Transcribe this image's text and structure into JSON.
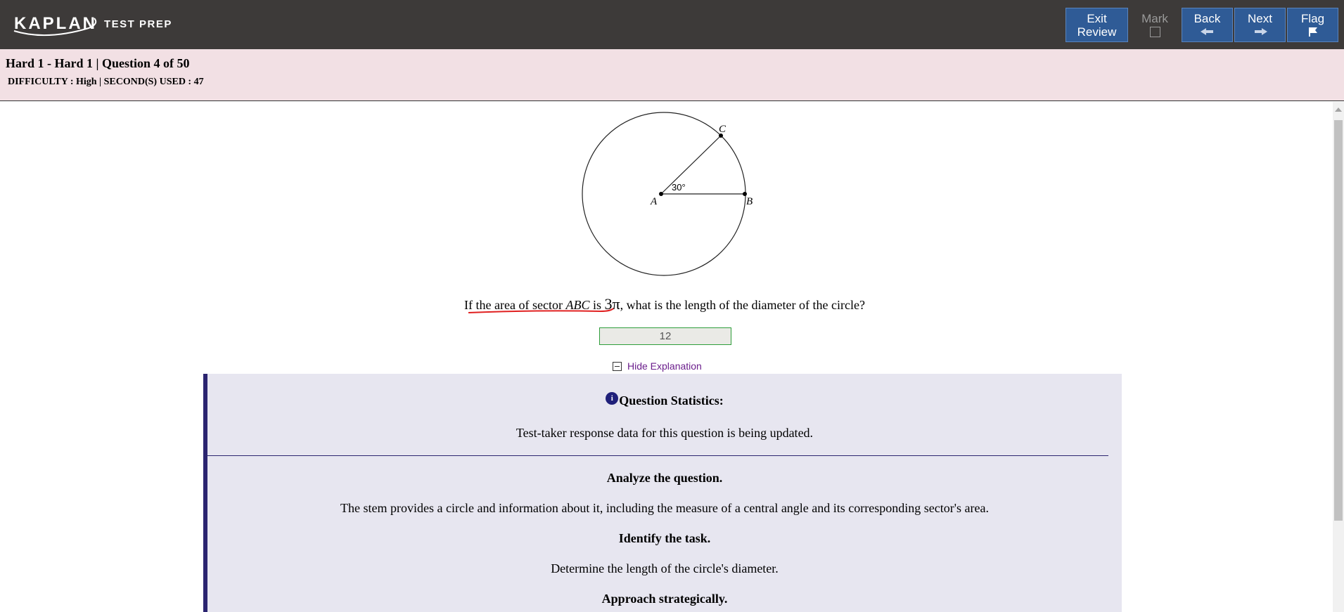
{
  "header": {
    "logo_brand": "KAPLAN",
    "logo_sub": "TEST PREP",
    "buttons": {
      "exit_line1": "Exit",
      "exit_line2": "Review",
      "mark": "Mark",
      "back": "Back",
      "next": "Next",
      "flag": "Flag"
    }
  },
  "info": {
    "title": "Hard 1 - Hard 1 | Question 4 of 50",
    "meta": "DIFFICULTY : High | SECOND(S) USED : 47"
  },
  "figure": {
    "label_a": "A",
    "label_b": "B",
    "label_c": "C",
    "angle": "30°"
  },
  "question": {
    "part1": "If the area of sector ",
    "sector": "ABC",
    "part2": " is ",
    "area": "3π",
    "part3": ", what is the length of the diameter of the circle?"
  },
  "answer": {
    "value": "12"
  },
  "toggle": {
    "label": "Hide Explanation"
  },
  "explanation": {
    "stats_heading": "Question Statistics:",
    "stats_text": "Test-taker response data for this question is being updated.",
    "h1": "Analyze the question.",
    "t1": "The stem provides a circle and information about it, including the measure of a central angle and its corresponding sector's area.",
    "h2": "Identify the task.",
    "t2": "Determine the length of the circle's diameter.",
    "h3": "Approach strategically."
  },
  "colors": {
    "topbar": "#3d3a39",
    "button_blue": "#2f5b96",
    "infobar": "#f2e0e4",
    "panel": "#e7e6f0",
    "panel_accent": "#2b2470",
    "answer_border": "#2e9e3a",
    "link_purple": "#6b1e8c",
    "spell_underline": "#e02020"
  }
}
